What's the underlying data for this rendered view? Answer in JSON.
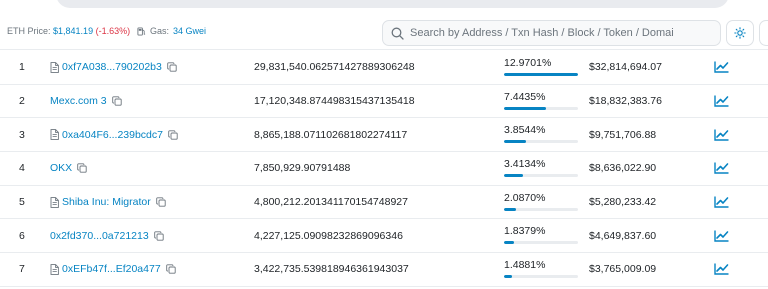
{
  "header": {
    "eth_price_label": "ETH Price:",
    "eth_price_value": "$1,841.19",
    "eth_price_change": "(-1.63%)",
    "gas_label": "Gas:",
    "gas_value": "34 Gwei",
    "search_placeholder": "Search by Address / Txn Hash / Block / Token / Domai",
    "theme_icon": "sun-icon"
  },
  "colors": {
    "link": "#0784c3",
    "negative": "#dc3545",
    "bar_fill": "#0784c3",
    "bar_track": "#e9ecef"
  },
  "holders": [
    {
      "rank": "1",
      "address": "0xf7A038...790202b3",
      "is_contract": true,
      "quantity": "29,831,540.062571427889306248",
      "percentage": "12.9701%",
      "percentage_fraction": 0.129701,
      "value": "$32,814,694.07"
    },
    {
      "rank": "2",
      "address": "Mexc.com 3",
      "is_contract": false,
      "quantity": "17,120,348.874498315437135418",
      "percentage": "7.4435%",
      "percentage_fraction": 0.074435,
      "value": "$18,832,383.76"
    },
    {
      "rank": "3",
      "address": "0xa404F6...239bcdc7",
      "is_contract": true,
      "quantity": "8,865,188.071102681802274117",
      "percentage": "3.8544%",
      "percentage_fraction": 0.038544,
      "value": "$9,751,706.88"
    },
    {
      "rank": "4",
      "address": "OKX",
      "is_contract": false,
      "quantity": "7,850,929.90791488",
      "percentage": "3.4134%",
      "percentage_fraction": 0.034134,
      "value": "$8,636,022.90"
    },
    {
      "rank": "5",
      "address": "Shiba Inu: Migrator",
      "is_contract": true,
      "quantity": "4,800,212.201341170154748927",
      "percentage": "2.0870%",
      "percentage_fraction": 0.02087,
      "value": "$5,280,233.42"
    },
    {
      "rank": "6",
      "address": "0x2fd370...0a721213",
      "is_contract": false,
      "quantity": "4,227,125.09098232869096346",
      "percentage": "1.8379%",
      "percentage_fraction": 0.018379,
      "value": "$4,649,837.60"
    },
    {
      "rank": "7",
      "address": "0xEFb47f...Ef20a477",
      "is_contract": true,
      "quantity": "3,422,735.539818946361943037",
      "percentage": "1.4881%",
      "percentage_fraction": 0.014881,
      "value": "$3,765,009.09"
    }
  ]
}
